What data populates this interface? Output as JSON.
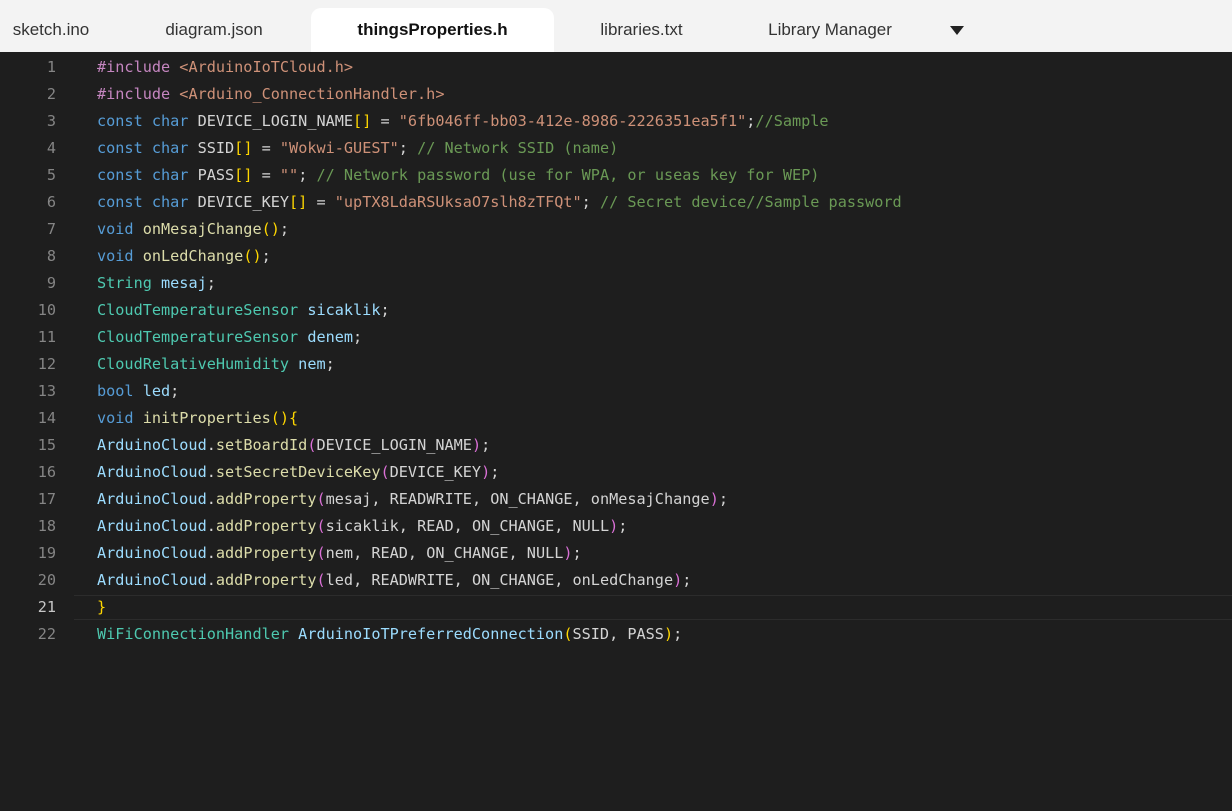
{
  "tabs": [
    {
      "label": "sketch.ino",
      "active": false
    },
    {
      "label": "diagram.json",
      "active": false
    },
    {
      "label": "thingsProperties.h",
      "active": true
    },
    {
      "label": "libraries.txt",
      "active": false
    },
    {
      "label": "Library Manager",
      "active": false
    }
  ],
  "tab_overflow_icon": "caret-down-icon",
  "editor": {
    "current_line": 21,
    "lines": [
      {
        "n": "1",
        "tokens": [
          {
            "t": "#include ",
            "c": "pp"
          },
          {
            "t": "<ArduinoIoTCloud.h>",
            "c": "str"
          }
        ]
      },
      {
        "n": "2",
        "tokens": [
          {
            "t": "#include ",
            "c": "pp"
          },
          {
            "t": "<Arduino_ConnectionHandler.h>",
            "c": "str"
          }
        ]
      },
      {
        "n": "3",
        "tokens": [
          {
            "t": "const ",
            "c": "kw"
          },
          {
            "t": "char ",
            "c": "kw"
          },
          {
            "t": "DEVICE_LOGIN_NAME",
            "c": ""
          },
          {
            "t": "[]",
            "c": "b1"
          },
          {
            "t": " = ",
            "c": ""
          },
          {
            "t": "\"6fb046ff-bb03-412e-8986-2226351ea5f1\"",
            "c": "str"
          },
          {
            "t": ";",
            "c": ""
          },
          {
            "t": "//Sample",
            "c": "cm"
          }
        ]
      },
      {
        "n": "4",
        "tokens": [
          {
            "t": "const ",
            "c": "kw"
          },
          {
            "t": "char ",
            "c": "kw"
          },
          {
            "t": "SSID",
            "c": ""
          },
          {
            "t": "[]",
            "c": "b1"
          },
          {
            "t": " = ",
            "c": ""
          },
          {
            "t": "\"Wokwi-GUEST\"",
            "c": "str"
          },
          {
            "t": "; ",
            "c": ""
          },
          {
            "t": "// Network SSID (name)",
            "c": "cm"
          }
        ]
      },
      {
        "n": "5",
        "tokens": [
          {
            "t": "const ",
            "c": "kw"
          },
          {
            "t": "char ",
            "c": "kw"
          },
          {
            "t": "PASS",
            "c": ""
          },
          {
            "t": "[]",
            "c": "b1"
          },
          {
            "t": " = ",
            "c": ""
          },
          {
            "t": "\"\"",
            "c": "str"
          },
          {
            "t": "; ",
            "c": ""
          },
          {
            "t": "// Network password (use for WPA, or useas key for WEP)",
            "c": "cm"
          }
        ]
      },
      {
        "n": "6",
        "tokens": [
          {
            "t": "const ",
            "c": "kw"
          },
          {
            "t": "char ",
            "c": "kw"
          },
          {
            "t": "DEVICE_KEY",
            "c": ""
          },
          {
            "t": "[]",
            "c": "b1"
          },
          {
            "t": " = ",
            "c": ""
          },
          {
            "t": "\"upTX8LdaRSUksaO7slh8zTFQt\"",
            "c": "str"
          },
          {
            "t": "; ",
            "c": ""
          },
          {
            "t": "// Secret device//Sample password",
            "c": "cm"
          }
        ]
      },
      {
        "n": "7",
        "tokens": [
          {
            "t": "void ",
            "c": "kw"
          },
          {
            "t": "onMesajChange",
            "c": "fn"
          },
          {
            "t": "()",
            "c": "b1"
          },
          {
            "t": ";",
            "c": ""
          }
        ]
      },
      {
        "n": "8",
        "tokens": [
          {
            "t": "void ",
            "c": "kw"
          },
          {
            "t": "onLedChange",
            "c": "fn"
          },
          {
            "t": "()",
            "c": "b1"
          },
          {
            "t": ";",
            "c": ""
          }
        ]
      },
      {
        "n": "9",
        "tokens": [
          {
            "t": "String ",
            "c": "ty"
          },
          {
            "t": "mesaj",
            "c": "id"
          },
          {
            "t": ";",
            "c": ""
          }
        ]
      },
      {
        "n": "10",
        "tokens": [
          {
            "t": "CloudTemperatureSensor ",
            "c": "ty"
          },
          {
            "t": "sicaklik",
            "c": "id"
          },
          {
            "t": ";",
            "c": ""
          }
        ]
      },
      {
        "n": "11",
        "tokens": [
          {
            "t": "CloudTemperatureSensor ",
            "c": "ty"
          },
          {
            "t": "denem",
            "c": "id"
          },
          {
            "t": ";",
            "c": ""
          }
        ]
      },
      {
        "n": "12",
        "tokens": [
          {
            "t": "CloudRelativeHumidity ",
            "c": "ty"
          },
          {
            "t": "nem",
            "c": "id"
          },
          {
            "t": ";",
            "c": ""
          }
        ]
      },
      {
        "n": "13",
        "tokens": [
          {
            "t": "bool ",
            "c": "kw"
          },
          {
            "t": "led",
            "c": "id"
          },
          {
            "t": ";",
            "c": ""
          }
        ]
      },
      {
        "n": "14",
        "tokens": [
          {
            "t": "void ",
            "c": "kw"
          },
          {
            "t": "initProperties",
            "c": "fn"
          },
          {
            "t": "()",
            "c": "b1"
          },
          {
            "t": "{",
            "c": "b1"
          }
        ]
      },
      {
        "n": "15",
        "tokens": [
          {
            "t": "ArduinoCloud",
            "c": "id"
          },
          {
            "t": ".",
            "c": ""
          },
          {
            "t": "setBoardId",
            "c": "fn"
          },
          {
            "t": "(",
            "c": "b2"
          },
          {
            "t": "DEVICE_LOGIN_NAME",
            "c": ""
          },
          {
            "t": ")",
            "c": "b2"
          },
          {
            "t": ";",
            "c": ""
          }
        ]
      },
      {
        "n": "16",
        "tokens": [
          {
            "t": "ArduinoCloud",
            "c": "id"
          },
          {
            "t": ".",
            "c": ""
          },
          {
            "t": "setSecretDeviceKey",
            "c": "fn"
          },
          {
            "t": "(",
            "c": "b2"
          },
          {
            "t": "DEVICE_KEY",
            "c": ""
          },
          {
            "t": ")",
            "c": "b2"
          },
          {
            "t": ";",
            "c": ""
          }
        ]
      },
      {
        "n": "17",
        "tokens": [
          {
            "t": "ArduinoCloud",
            "c": "id"
          },
          {
            "t": ".",
            "c": ""
          },
          {
            "t": "addProperty",
            "c": "fn"
          },
          {
            "t": "(",
            "c": "b2"
          },
          {
            "t": "mesaj, READWRITE, ON_CHANGE, onMesajChange",
            "c": ""
          },
          {
            "t": ")",
            "c": "b2"
          },
          {
            "t": ";",
            "c": ""
          }
        ]
      },
      {
        "n": "18",
        "tokens": [
          {
            "t": "ArduinoCloud",
            "c": "id"
          },
          {
            "t": ".",
            "c": ""
          },
          {
            "t": "addProperty",
            "c": "fn"
          },
          {
            "t": "(",
            "c": "b2"
          },
          {
            "t": "sicaklik, READ, ON_CHANGE, NULL",
            "c": ""
          },
          {
            "t": ")",
            "c": "b2"
          },
          {
            "t": ";",
            "c": ""
          }
        ]
      },
      {
        "n": "19",
        "tokens": [
          {
            "t": "ArduinoCloud",
            "c": "id"
          },
          {
            "t": ".",
            "c": ""
          },
          {
            "t": "addProperty",
            "c": "fn"
          },
          {
            "t": "(",
            "c": "b2"
          },
          {
            "t": "nem, READ, ON_CHANGE, NULL",
            "c": ""
          },
          {
            "t": ")",
            "c": "b2"
          },
          {
            "t": ";",
            "c": ""
          }
        ]
      },
      {
        "n": "20",
        "tokens": [
          {
            "t": "ArduinoCloud",
            "c": "id"
          },
          {
            "t": ".",
            "c": ""
          },
          {
            "t": "addProperty",
            "c": "fn"
          },
          {
            "t": "(",
            "c": "b2"
          },
          {
            "t": "led, READWRITE, ON_CHANGE, onLedChange",
            "c": ""
          },
          {
            "t": ")",
            "c": "b2"
          },
          {
            "t": ";",
            "c": ""
          }
        ]
      },
      {
        "n": "21",
        "tokens": [
          {
            "t": "}",
            "c": "b1"
          }
        ]
      },
      {
        "n": "22",
        "tokens": [
          {
            "t": "WiFiConnectionHandler ",
            "c": "ty"
          },
          {
            "t": "ArduinoIoTPreferredConnection",
            "c": "id"
          },
          {
            "t": "(",
            "c": "b1"
          },
          {
            "t": "SSID, PASS",
            "c": ""
          },
          {
            "t": ")",
            "c": "b1"
          },
          {
            "t": ";",
            "c": ""
          }
        ]
      }
    ]
  }
}
